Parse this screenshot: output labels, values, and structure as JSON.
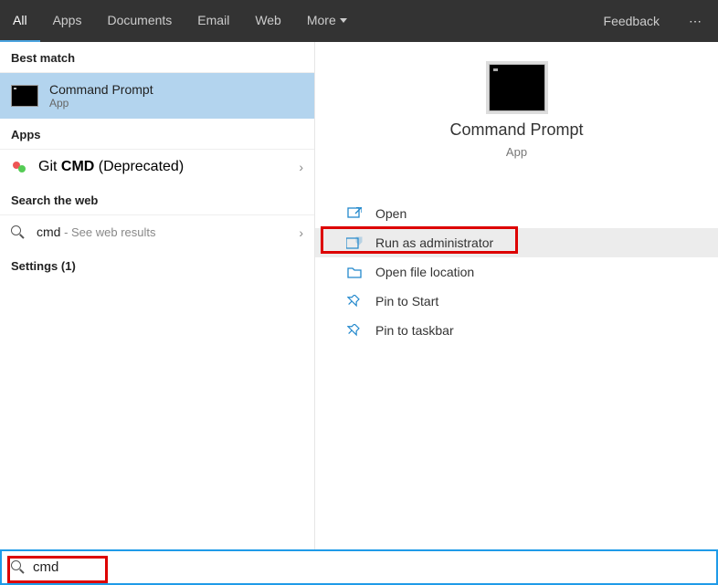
{
  "header": {
    "tabs": [
      {
        "label": "All",
        "active": true
      },
      {
        "label": "Apps"
      },
      {
        "label": "Documents"
      },
      {
        "label": "Email"
      },
      {
        "label": "Web"
      },
      {
        "label": "More"
      }
    ],
    "feedback": "Feedback"
  },
  "left": {
    "best_match_header": "Best match",
    "best_match": {
      "title": "Command Prompt",
      "sub": "App"
    },
    "apps_header": "Apps",
    "apps": [
      {
        "prefix": "Git ",
        "bold": "CMD",
        "suffix": " (Deprecated)"
      }
    ],
    "search_web_header": "Search the web",
    "web": {
      "query": "cmd",
      "hint": " - See web results"
    },
    "settings_header": "Settings (1)"
  },
  "right": {
    "title": "Command Prompt",
    "sub": "App",
    "actions": [
      {
        "label": "Open",
        "icon": "open"
      },
      {
        "label": "Run as administrator",
        "icon": "admin",
        "highlighted": true
      },
      {
        "label": "Open file location",
        "icon": "folder"
      },
      {
        "label": "Pin to Start",
        "icon": "pin"
      },
      {
        "label": "Pin to taskbar",
        "icon": "pin"
      }
    ]
  },
  "footer": {
    "search_value": "cmd"
  }
}
